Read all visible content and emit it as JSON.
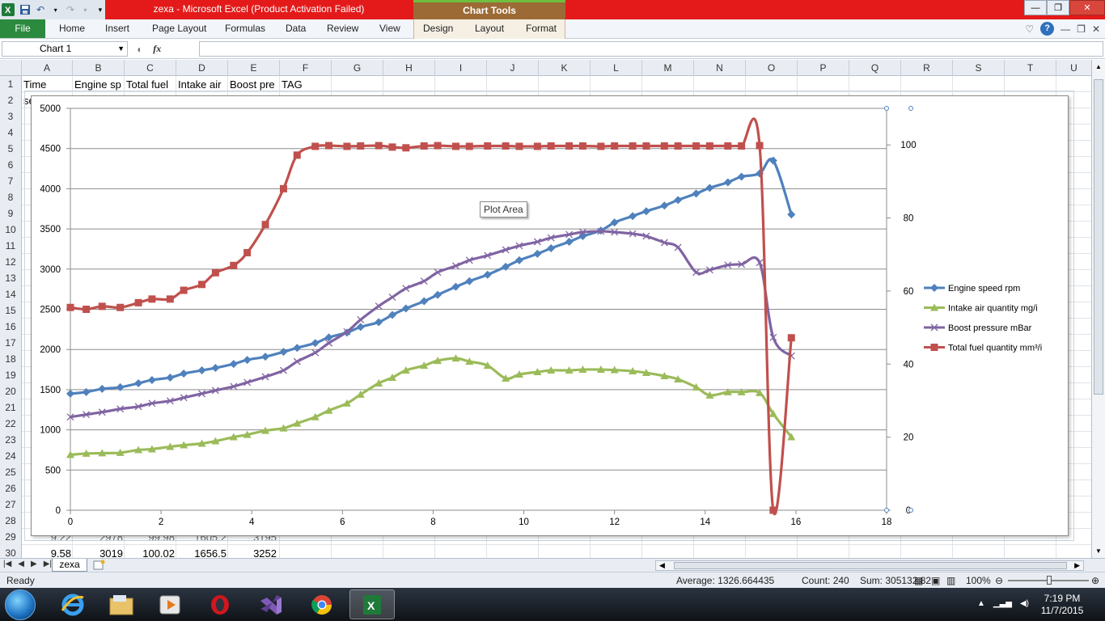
{
  "titlebar": {
    "title": "zexa  -  Microsoft Excel (Product Activation Failed)",
    "chart_tools": "Chart Tools",
    "minimize": "—",
    "restore": "❐",
    "close": "✕"
  },
  "ribbon": {
    "file": "File",
    "tabs": [
      "Home",
      "Insert",
      "Page Layout",
      "Formulas",
      "Data",
      "Review",
      "View",
      "Design",
      "Layout",
      "Format"
    ]
  },
  "formula_bar": {
    "name_box": "Chart 1",
    "fx": "fx",
    "formula": ""
  },
  "columns": [
    "A",
    "B",
    "C",
    "D",
    "E",
    "F",
    "G",
    "H",
    "I",
    "J",
    "K",
    "L",
    "M",
    "N",
    "O",
    "P",
    "Q",
    "R",
    "S",
    "T",
    "U"
  ],
  "rows": [
    "1",
    "2",
    "3",
    "4",
    "5",
    "6",
    "7",
    "8",
    "9",
    "10",
    "11",
    "12",
    "13",
    "14",
    "15",
    "16",
    "17",
    "18",
    "19",
    "20",
    "21",
    "22",
    "23",
    "24",
    "25",
    "26",
    "27",
    "28",
    "29",
    "30"
  ],
  "cells": {
    "header_row": [
      "Time",
      "Engine sp",
      "Total fuel",
      "Intake air",
      "Boost pre",
      "TAG"
    ],
    "row2_a": "se",
    "row29": [
      "9.22",
      "2978",
      "99.98",
      "1605.2",
      "3195"
    ],
    "row30": [
      "9.58",
      "3019",
      "100.02",
      "1656.5",
      "3252"
    ]
  },
  "tooltip": "Plot Area",
  "sheet": {
    "tab": "zexa"
  },
  "status": {
    "ready": "Ready",
    "average": "Average: 1326.664435",
    "count": "Count: 240",
    "sum": "Sum: 305132.82",
    "zoom": "100%"
  },
  "taskbar": {
    "time": "7:19 PM",
    "date": "11/7/2015"
  },
  "colors": {
    "engine": "#4f81bd",
    "intake": "#9bbb59",
    "boost": "#8064a2",
    "fuel": "#c0504d",
    "titlebar": "#e41a1a"
  },
  "chart_data": {
    "type": "line",
    "x_axis": {
      "ticks": [
        0,
        2,
        4,
        6,
        8,
        10,
        12,
        14,
        16,
        18
      ],
      "range": [
        0,
        18
      ]
    },
    "y_left": {
      "ticks": [
        0,
        500,
        1000,
        1500,
        2000,
        2500,
        3000,
        3500,
        4000,
        4500,
        5000
      ],
      "range": [
        0,
        5000
      ]
    },
    "y_right": {
      "ticks": [
        0,
        20,
        40,
        60,
        80,
        100
      ],
      "range": [
        0,
        110
      ]
    },
    "grid": "horizontal",
    "legend_position": "right",
    "series": [
      {
        "name": "Engine speed rpm",
        "axis": "left",
        "color": "#4f81bd",
        "marker": "diamond",
        "x": [
          0,
          0.35,
          0.7,
          1.1,
          1.5,
          1.8,
          2.2,
          2.5,
          2.9,
          3.2,
          3.6,
          3.9,
          4.3,
          4.7,
          5.0,
          5.4,
          5.7,
          6.1,
          6.4,
          6.8,
          7.1,
          7.4,
          7.8,
          8.1,
          8.5,
          8.8,
          9.2,
          9.6,
          9.9,
          10.3,
          10.6,
          11.0,
          11.3,
          11.7,
          12.0,
          12.4,
          12.7,
          13.1,
          13.4,
          13.8,
          14.1,
          14.5,
          14.8,
          15.2,
          15.5,
          15.9
        ],
        "values": [
          1450,
          1470,
          1510,
          1530,
          1580,
          1620,
          1650,
          1700,
          1740,
          1770,
          1820,
          1870,
          1910,
          1970,
          2020,
          2080,
          2150,
          2210,
          2280,
          2340,
          2430,
          2510,
          2600,
          2680,
          2780,
          2850,
          2930,
          3030,
          3110,
          3190,
          3260,
          3340,
          3410,
          3480,
          3580,
          3660,
          3720,
          3790,
          3860,
          3940,
          4010,
          4080,
          4150,
          4190,
          4350,
          3680
        ]
      },
      {
        "name": "Intake air quantity mg/i",
        "axis": "left",
        "color": "#9bbb59",
        "marker": "triangle",
        "x": [
          0,
          0.35,
          0.7,
          1.1,
          1.5,
          1.8,
          2.2,
          2.5,
          2.9,
          3.2,
          3.6,
          3.9,
          4.3,
          4.7,
          5.0,
          5.4,
          5.7,
          6.1,
          6.4,
          6.8,
          7.1,
          7.4,
          7.8,
          8.1,
          8.5,
          8.8,
          9.2,
          9.6,
          9.9,
          10.3,
          10.6,
          11.0,
          11.3,
          11.7,
          12.0,
          12.4,
          12.7,
          13.1,
          13.4,
          13.8,
          14.1,
          14.5,
          14.8,
          15.2,
          15.5,
          15.9
        ],
        "values": [
          690,
          705,
          710,
          715,
          750,
          760,
          790,
          810,
          830,
          860,
          910,
          940,
          990,
          1020,
          1080,
          1160,
          1240,
          1330,
          1440,
          1580,
          1650,
          1740,
          1800,
          1860,
          1890,
          1850,
          1800,
          1640,
          1690,
          1720,
          1740,
          1740,
          1750,
          1750,
          1745,
          1730,
          1710,
          1670,
          1630,
          1530,
          1430,
          1470,
          1470,
          1460,
          1200,
          910
        ]
      },
      {
        "name": "Boost pressure mBar",
        "axis": "left",
        "color": "#8064a2",
        "marker": "x",
        "x": [
          0,
          0.35,
          0.7,
          1.1,
          1.5,
          1.8,
          2.2,
          2.5,
          2.9,
          3.2,
          3.6,
          3.9,
          4.3,
          4.7,
          5.0,
          5.4,
          5.7,
          6.1,
          6.4,
          6.8,
          7.1,
          7.4,
          7.8,
          8.1,
          8.5,
          8.8,
          9.2,
          9.6,
          9.9,
          10.3,
          10.6,
          11.0,
          11.3,
          11.7,
          12.0,
          12.4,
          12.7,
          13.1,
          13.4,
          13.8,
          14.1,
          14.5,
          14.8,
          15.2,
          15.5,
          15.9
        ],
        "values": [
          1160,
          1190,
          1220,
          1260,
          1290,
          1330,
          1360,
          1400,
          1450,
          1490,
          1540,
          1590,
          1660,
          1740,
          1850,
          1960,
          2080,
          2220,
          2370,
          2540,
          2650,
          2760,
          2850,
          2960,
          3040,
          3110,
          3170,
          3240,
          3290,
          3340,
          3390,
          3430,
          3460,
          3470,
          3460,
          3440,
          3410,
          3330,
          3270,
          2960,
          2990,
          3050,
          3060,
          3080,
          2150,
          1920
        ]
      },
      {
        "name": "Total fuel quantity mm³/i",
        "axis": "right",
        "color": "#c0504d",
        "marker": "square",
        "x": [
          0,
          0.35,
          0.7,
          1.1,
          1.5,
          1.8,
          2.2,
          2.5,
          2.9,
          3.2,
          3.6,
          3.9,
          4.3,
          4.7,
          5.0,
          5.4,
          5.7,
          6.1,
          6.4,
          6.8,
          7.1,
          7.4,
          7.8,
          8.1,
          8.5,
          8.8,
          9.2,
          9.6,
          9.9,
          10.3,
          10.6,
          11.0,
          11.3,
          11.7,
          12.0,
          12.4,
          12.7,
          13.1,
          13.4,
          13.8,
          14.1,
          14.5,
          14.8,
          15.2,
          15.5,
          15.9
        ],
        "values": [
          55.5,
          55,
          55.8,
          55.5,
          56.8,
          57.8,
          57.8,
          60.2,
          61.8,
          65,
          67,
          70.5,
          78.2,
          88,
          97.2,
          99.6,
          99.8,
          99.6,
          99.7,
          99.8,
          99.4,
          99.2,
          99.7,
          99.8,
          99.6,
          99.6,
          99.7,
          99.7,
          99.6,
          99.6,
          99.7,
          99.7,
          99.7,
          99.6,
          99.7,
          99.7,
          99.7,
          99.7,
          99.7,
          99.7,
          99.7,
          99.7,
          99.7,
          99.8,
          0,
          47.2
        ]
      }
    ]
  }
}
